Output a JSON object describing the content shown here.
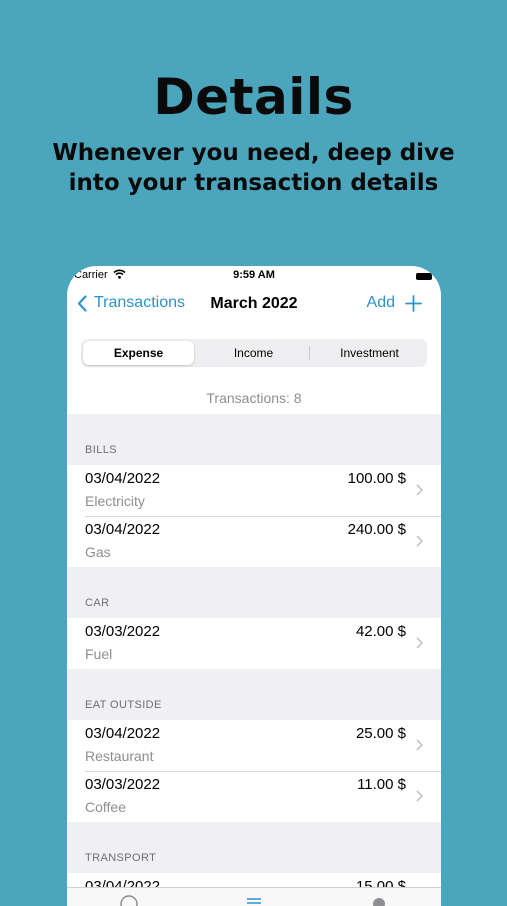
{
  "promo": {
    "title": "Details",
    "subtitle_line1": "Whenever you need, deep dive",
    "subtitle_line2": "into your transaction details"
  },
  "status_bar": {
    "carrier": "Carrier",
    "time": "9:59 AM"
  },
  "nav": {
    "back_label": "Transactions",
    "title": "March 2022",
    "add_label": "Add"
  },
  "segments": {
    "options": [
      "Expense",
      "Income",
      "Investment"
    ],
    "selected": "Expense"
  },
  "transactions_count": "Transactions: 8",
  "sections": [
    {
      "header": "BILLS",
      "rows": [
        {
          "date": "03/04/2022",
          "category": "Electricity",
          "amount": "100.00 $"
        },
        {
          "date": "03/04/2022",
          "category": "Gas",
          "amount": "240.00 $"
        }
      ]
    },
    {
      "header": "CAR",
      "rows": [
        {
          "date": "03/03/2022",
          "category": "Fuel",
          "amount": "42.00 $"
        }
      ]
    },
    {
      "header": "EAT OUTSIDE",
      "rows": [
        {
          "date": "03/04/2022",
          "category": "Restaurant",
          "amount": "25.00 $"
        },
        {
          "date": "03/03/2022",
          "category": "Coffee",
          "amount": "11.00 $"
        }
      ]
    },
    {
      "header": "TRANSPORT",
      "rows": [
        {
          "date": "03/04/2022",
          "category": "",
          "amount": "15.00 $"
        }
      ]
    }
  ],
  "tab_bar": {
    "icons": [
      "pie-chart-icon",
      "list-icon",
      "gear-icon"
    ]
  },
  "colors": {
    "background": "#4ba6bd",
    "accent": "#2e93c9"
  }
}
